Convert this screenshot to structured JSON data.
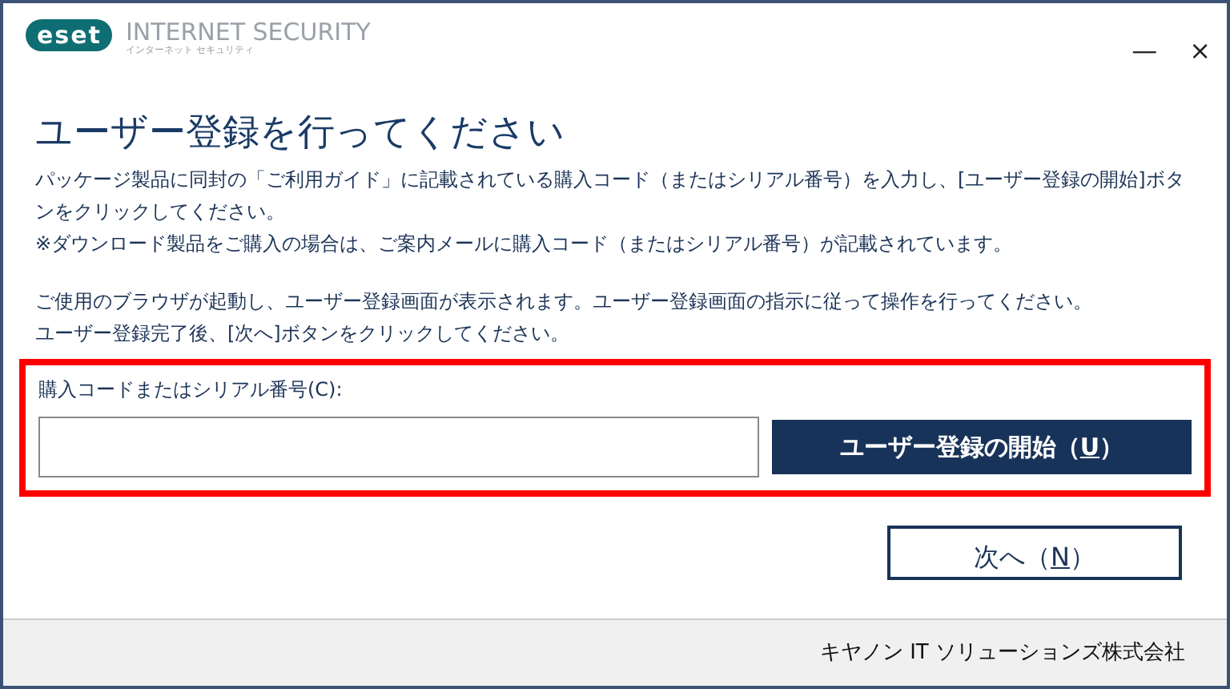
{
  "logo": {
    "brand": "eset",
    "product": "INTERNET SECURITY",
    "product_kana": "インターネット セキュリティ"
  },
  "window_controls": [
    "—",
    "×"
  ],
  "title": "ユーザー登録を行ってください",
  "paragraphs": [
    [
      "パッケージ製品に同封の「ご利用ガイド」に記載されている購入コード（またはシリアル番号）を入力し、[ユーザー登録の開始]ボタンをクリックしてください。",
      "※ダウンロード製品をご購入の場合は、ご案内メールに購入コード（またはシリアル番号）が記載されています。"
    ],
    [
      "ご使用のブラウザが起動し、ユーザー登録画面が表示されます。ユーザー登録画面の指示に従って操作を行ってください。",
      "ユーザー登録完了後、[次へ]ボタンをクリックしてください。"
    ]
  ],
  "code_section": {
    "highlighted": true,
    "label": "購入コードまたはシリアル番号(C):",
    "start_button": {
      "before": "ユーザー登録の開始（",
      "access_key": "U",
      "after": "）"
    }
  },
  "next_button": {
    "before": "次へ（",
    "access_key": "N",
    "after": "）"
  },
  "footer": "キヤノン IT ソリューションズ株式会社"
}
